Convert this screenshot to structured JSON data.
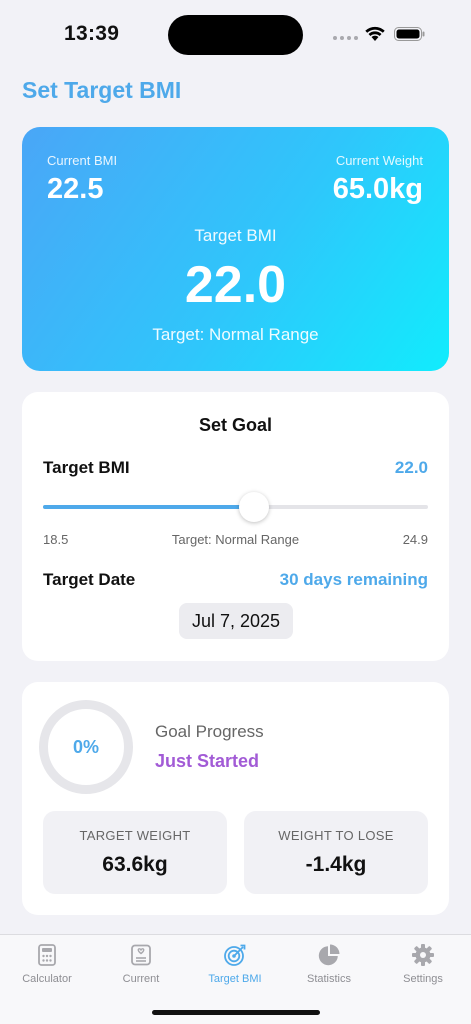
{
  "status_bar": {
    "time": "13:39"
  },
  "page_title": "Set Target BMI",
  "hero": {
    "current_bmi_label": "Current BMI",
    "current_bmi": "22.5",
    "current_weight_label": "Current Weight",
    "current_weight": "65.0kg",
    "target_bmi_label": "Target BMI",
    "target_bmi": "22.0",
    "range_text": "Target: Normal Range",
    "gradient_start": "#4aa6f7",
    "gradient_end": "#11ecfd"
  },
  "goal": {
    "title": "Set Goal",
    "target_bmi_label": "Target BMI",
    "target_bmi_value": "22.0",
    "slider": {
      "min": 18.5,
      "max": 24.9,
      "value": 22.0,
      "min_label": "18.5",
      "max_label": "24.9",
      "mid_label": "Target: Normal Range"
    },
    "target_date_label": "Target Date",
    "target_date_remaining": "30 days remaining",
    "target_date": "Jul 7, 2025"
  },
  "progress": {
    "percent": 0,
    "percent_label": "0%",
    "label": "Goal Progress",
    "status": "Just Started",
    "target_weight_label": "TARGET WEIGHT",
    "target_weight": "63.6kg",
    "weight_to_lose_label": "WEIGHT TO LOSE",
    "weight_to_lose": "-1.4kg"
  },
  "tabs": [
    {
      "label": "Calculator",
      "icon": "calculator-icon",
      "active": false
    },
    {
      "label": "Current",
      "icon": "scale-icon",
      "active": false
    },
    {
      "label": "Target BMI",
      "icon": "target-icon",
      "active": true
    },
    {
      "label": "Statistics",
      "icon": "pie-chart-icon",
      "active": false
    },
    {
      "label": "Settings",
      "icon": "gear-icon",
      "active": false
    }
  ],
  "colors": {
    "accent": "#4ea9ea",
    "status_purple": "#a25bd6",
    "inactive_tab": "#8e8e93"
  }
}
